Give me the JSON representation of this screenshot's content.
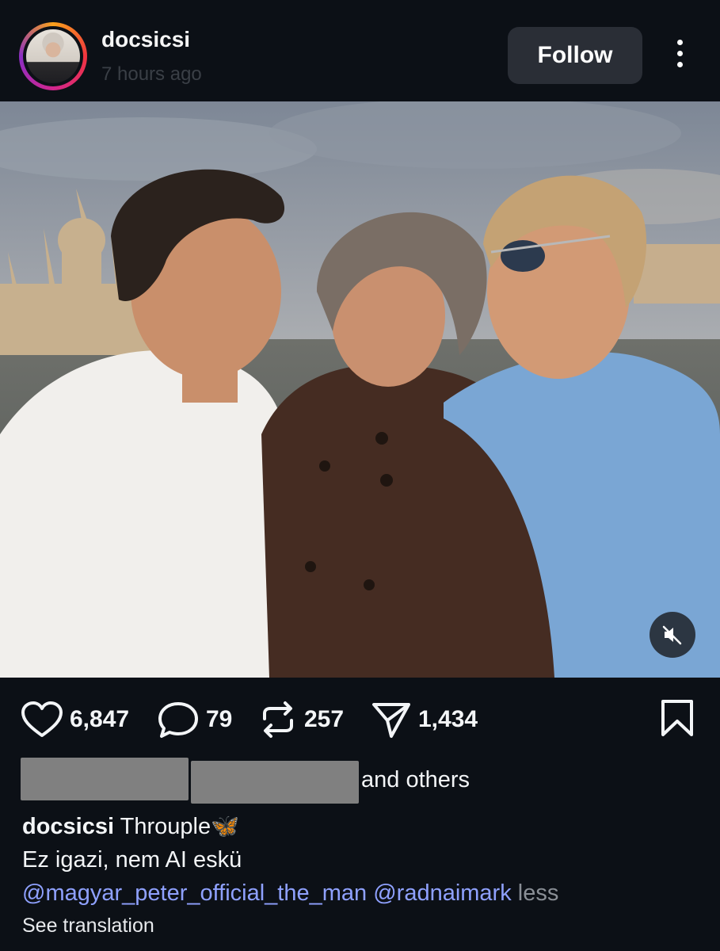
{
  "header": {
    "username": "docsicsi",
    "time": "7 hours ago",
    "follow_label": "Follow",
    "more_icon": "more-vertical-icon"
  },
  "photo": {
    "description_icon": "selfie-photo",
    "mute_icon": "sound-off-icon"
  },
  "actions": {
    "likes": "6,847",
    "comments": "79",
    "reposts": "257",
    "shares": "1,434"
  },
  "liked_by": {
    "suffix": "and others"
  },
  "caption": {
    "username": "docsicsi",
    "text": "Throuple",
    "emoji": "🦋",
    "line2": "Ez igazi, nem AI eskü",
    "mention1": "@magyar_peter_official_the_man",
    "mention2": "@radnaimark",
    "less": "less",
    "see_translation": "See translation"
  },
  "colors": {
    "background": "#0c1016",
    "mention": "#8fa1ff",
    "button": "#2a2e36"
  }
}
